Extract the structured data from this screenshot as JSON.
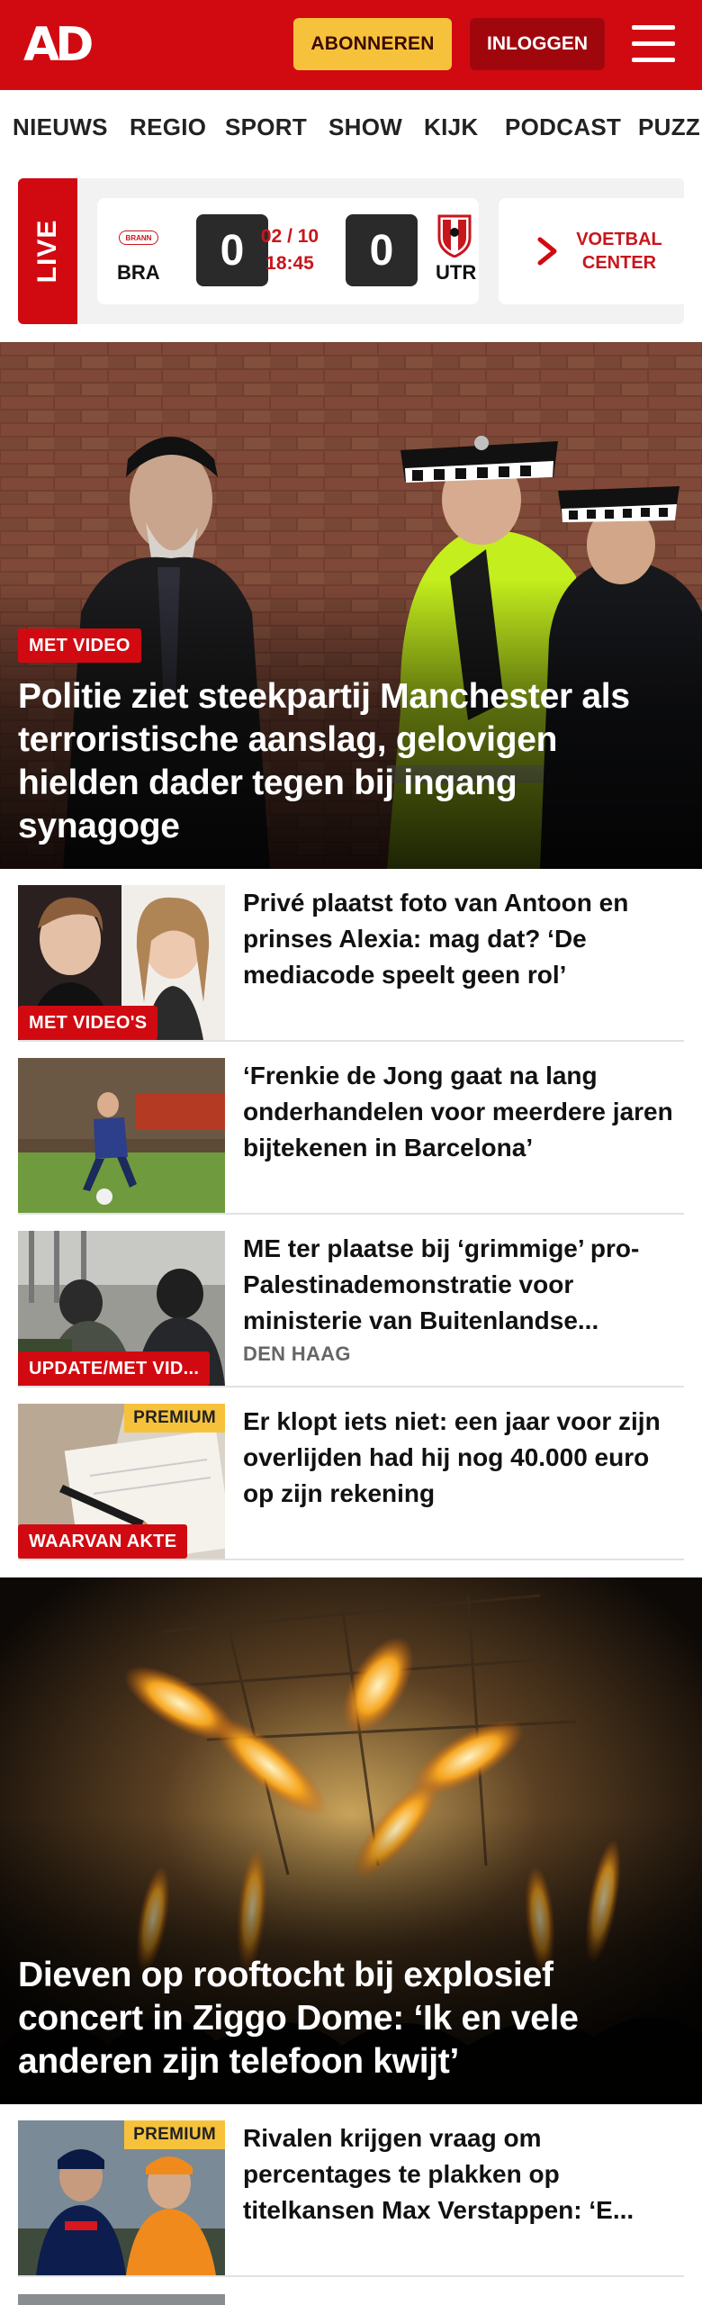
{
  "header": {
    "logo": "AD",
    "subscribe_label": "ABONNEREN",
    "login_label": "INLOGGEN"
  },
  "nav": {
    "items": [
      "NIEUWS",
      "REGIO",
      "SPORT",
      "SHOW",
      "KIJK",
      "PODCAST",
      "PUZZ"
    ]
  },
  "live": {
    "label": "LIVE",
    "match": {
      "home_team": "BRA",
      "home_logo_text": "BRANN",
      "home_score": "0",
      "date": "02 / 10",
      "time": "18:45",
      "away_score": "0",
      "away_team": "UTR"
    },
    "voetbalcenter_line1": "VOETBAL",
    "voetbalcenter_line2": "CENTER"
  },
  "hero": {
    "badge": "MET VIDEO",
    "title": "Politie ziet steekpartij Manchester als terroristische aanslag, gelovigen hielden dader tegen bij ingang synagoge"
  },
  "articles": [
    {
      "badge": "MET VIDEO'S",
      "premium": "",
      "title": "Privé plaatst foto van Antoon en prinses Alexia: mag dat? ‘De mediacode speelt geen rol’",
      "subtitle": ""
    },
    {
      "badge": "",
      "premium": "",
      "title": "‘Frenkie de Jong gaat na lang onderhandelen voor meerdere jaren bijtekenen in Barcelona’",
      "subtitle": ""
    },
    {
      "badge": "UPDATE/MET VID...",
      "premium": "",
      "title": "ME ter plaatse bij ‘grimmige’ pro-Palestinademonstratie voor ministerie van Buitenlandse...",
      "subtitle": "DEN HAAG"
    },
    {
      "badge": "WAARVAN AKTE",
      "premium": "PREMIUM",
      "title": "Er klopt iets niet: een jaar voor zijn overlijden had hij nog 40.000 euro op zijn rekening",
      "subtitle": ""
    }
  ],
  "feature": {
    "title": "Dieven op rooftocht bij explosief concert in Ziggo Dome: ‘Ik en vele anderen zijn telefoon kwijt’"
  },
  "articles2": [
    {
      "badge": "",
      "premium": "PREMIUM",
      "title": "Rivalen krijgen vraag om percentages te plakken op titelkansen Max Verstappen: ‘E...",
      "subtitle": ""
    }
  ],
  "colors": {
    "brand_red": "#d10a11",
    "premium_yellow": "#f7c23b",
    "login_dark_red": "#a0070d"
  }
}
